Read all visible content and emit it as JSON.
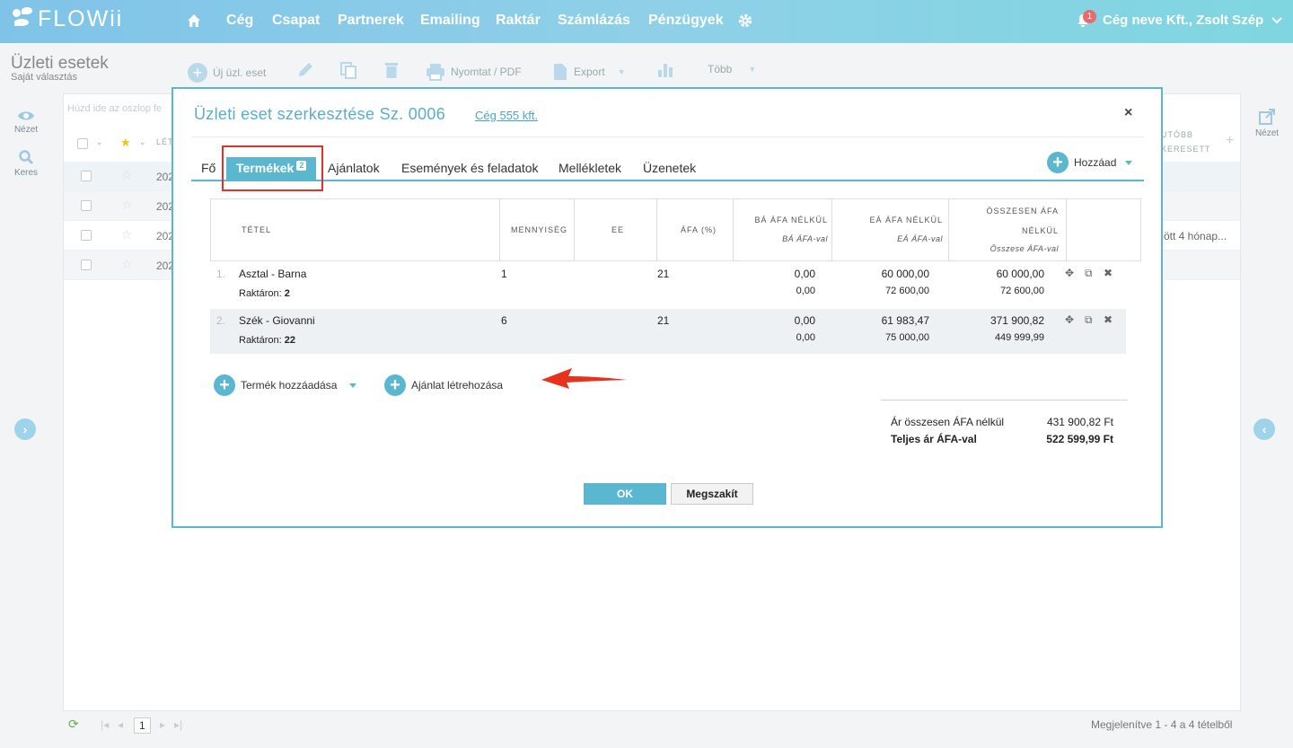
{
  "brand": {
    "name": "FLOWii"
  },
  "nav": {
    "items": [
      "Cég",
      "Csapat",
      "Partnerek",
      "Emailing",
      "Raktár",
      "Számlázás",
      "Pénzügyek"
    ],
    "company": "Cég neve Kft., Zsolt Szép",
    "notification_count": "1"
  },
  "page": {
    "title": "Üzleti esetek",
    "subtitle": "Saját választás"
  },
  "toolbar": {
    "new": "Új üzl. eset",
    "print": "Nyomtat / PDF",
    "export": "Export",
    "more": "Több"
  },
  "sidebar": {
    "view": "Nézet",
    "search": "Keres",
    "right_view": "Nézet"
  },
  "grid": {
    "drag_hint": "Húzd ide az oszlop fe",
    "header_partial": "LÉT",
    "right_header_1": "UTÓBB",
    "right_header_2": "KERESETT",
    "rows": [
      {
        "year": "202"
      },
      {
        "year": "202"
      },
      {
        "year": "202",
        "right_text": "ött  4 hónap..."
      },
      {
        "year": "202"
      }
    ],
    "page_number": "1",
    "footer": "Megjelenítve 1 - 4 a 4 tételből"
  },
  "modal": {
    "title": "Üzleti eset szerkesztése Sz. 0006",
    "company_link": "Cég 555 kft.",
    "close": "×",
    "tabs": {
      "main": "Fő",
      "products": "Termékek",
      "products_badge": "2",
      "offers": "Ajánlatok",
      "events": "Események és feladatok",
      "attachments": "Mellékletek",
      "messages": "Üzenetek"
    },
    "add_label": "Hozzáad",
    "table": {
      "col_item": "TÉTEL",
      "col_qty": "MENNYISÉG",
      "col_unit": "EE",
      "col_vat": "ÁFA (%)",
      "col_ba": "BÁ ÁFA NÉLKÜL",
      "col_ba_sub": "BÁ ÁFA-val",
      "col_ea": "EÁ ÁFA NÉLKÜL",
      "col_ea_sub": "EÁ ÁFA-val",
      "col_total_1": "ÖSSZESEN ÁFA",
      "col_total_2": "NÉLKÜL",
      "col_total_sub": "Összese ÁFA-val"
    },
    "stock_label": "Raktáron:",
    "products": [
      {
        "num": "1.",
        "name": "Asztal - Barna",
        "stock": "2",
        "qty": "1",
        "vat": "21",
        "ba": "0,00",
        "ba_vat": "0,00",
        "ea": "60 000,00",
        "ea_vat": "72 600,00",
        "total": "60 000,00",
        "total_vat": "72 600,00"
      },
      {
        "num": "2.",
        "name": "Szék - Giovanni",
        "stock": "22",
        "qty": "6",
        "vat": "21",
        "ba": "0,00",
        "ba_vat": "0,00",
        "ea": "61 983,47",
        "ea_vat": "75 000,00",
        "total": "371 900,82",
        "total_vat": "449 999,99"
      }
    ],
    "add_product": "Termék hozzáadása",
    "create_offer": "Ajánlat létrehozása",
    "summary": {
      "net_label": "Ár összesen ÁFA nélkül",
      "net_value": "431 900,82 Ft",
      "gross_label": "Teljes ár ÁFA-val",
      "gross_value": "522 599,99 Ft"
    },
    "ok": "OK",
    "cancel": "Megszakít"
  },
  "colors": {
    "accent": "#5bb7cf",
    "highlight": "#e0322a",
    "nav": "#7fc3e8"
  }
}
